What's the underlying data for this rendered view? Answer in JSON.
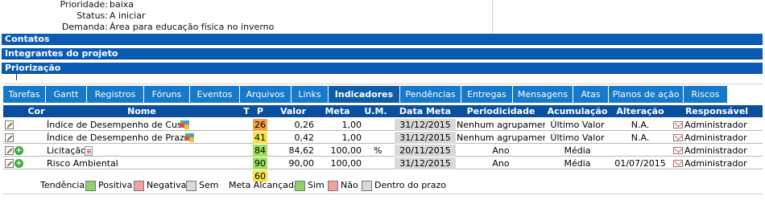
{
  "info": {
    "rows": [
      {
        "key": "Prioridade:",
        "value": "baixa"
      },
      {
        "key": "Status:",
        "value": "A iniciar"
      },
      {
        "key": "Demanda:",
        "value": "Área para educação física no inverno"
      }
    ]
  },
  "sections": {
    "contatos": "Contatos",
    "integrantes": "Integrantes do projeto",
    "priorizacao": "Priorização"
  },
  "tabs": [
    {
      "label": "Tarefas"
    },
    {
      "label": "Gantt"
    },
    {
      "label": "Registros"
    },
    {
      "label": "Fóruns"
    },
    {
      "label": "Eventos"
    },
    {
      "label": "Arquivos"
    },
    {
      "label": "Links"
    },
    {
      "label": "Indicadores",
      "active": true
    },
    {
      "label": "Pendências"
    },
    {
      "label": "Entregas"
    },
    {
      "label": "Mensagens"
    },
    {
      "label": "Atas"
    },
    {
      "label": "Planos de ação"
    },
    {
      "label": "Riscos"
    }
  ],
  "table": {
    "headers": {
      "cor": "Cor",
      "nome": "Nome",
      "t": "T",
      "p": "P",
      "valor": "Valor",
      "meta": "Meta",
      "um": "U.M.",
      "data_meta": "Data Meta",
      "periodicidade": "Periodicidade",
      "acumulacao": "Acumulação",
      "alteracao": "Alteração",
      "responsavel": "Responsável"
    },
    "rows": [
      {
        "nome": "Índice de Desempenho de Custo",
        "p": "26",
        "p_color": "orange",
        "valor": "0,26",
        "meta": "1,00",
        "um": "",
        "data_meta": "31/12/2015",
        "periodicidade": "Nenhum agrupamento",
        "acumulacao": "Último Valor",
        "alteracao": "N.A.",
        "responsavel": "Administrador",
        "icon": "puzzle-icon",
        "has_add": false
      },
      {
        "nome": "Índice de Desempenho de Prazo",
        "p": "41",
        "p_color": "yellow",
        "valor": "0,42",
        "meta": "1,00",
        "um": "",
        "data_meta": "31/12/2015",
        "periodicidade": "Nenhum agrupamento",
        "acumulacao": "Último Valor",
        "alteracao": "N.A.",
        "responsavel": "Administrador",
        "icon": "puzzle-icon",
        "has_add": false
      },
      {
        "nome": "Licitação",
        "p": "84",
        "p_color": "green",
        "valor": "84,62",
        "meta": "100,00",
        "um": "%",
        "data_meta": "20/11/2015",
        "periodicidade": "Ano",
        "acumulacao": "Média",
        "alteracao": "",
        "responsavel": "Administrador",
        "icon": "document-icon",
        "has_add": true
      },
      {
        "nome": "Risco Ambiental",
        "p": "90",
        "p_color": "green",
        "valor": "90,00",
        "meta": "100,00",
        "um": "",
        "data_meta": "31/12/2015",
        "periodicidade": "Ano",
        "acumulacao": "Média",
        "alteracao": "01/07/2015",
        "responsavel": "Administrador",
        "icon": "",
        "has_add": true
      }
    ],
    "total_p": "60"
  },
  "legend": {
    "tendencia": "Tendência:",
    "positiva": "Positiva",
    "negativa": "Negativa",
    "sem": "Sem",
    "meta_alcancada": "Meta Alcançada:",
    "sim": "Sim",
    "nao": "Não",
    "dentro_prazo": "Dentro do prazo"
  },
  "colors": {
    "bar_blue": "#0a5bb4",
    "tab_blue": "#1679c9",
    "header_blue": "#0a4f9e",
    "orange": "#f5a046",
    "yellow": "#f3e24e",
    "green": "#9ee05c",
    "legend_green": "#8fd16a",
    "legend_red": "#f4a0a0",
    "legend_gray": "#d9d9d9"
  }
}
